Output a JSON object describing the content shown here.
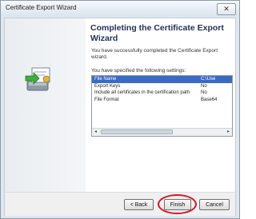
{
  "window": {
    "title": "Certificate Export Wizard",
    "close_label": "✕"
  },
  "content": {
    "heading": "Completing the Certificate Export Wizard",
    "description": "You have successfully completed the Certificate Export wizard.",
    "settings_label": "You have specified the following settings:"
  },
  "settings": [
    {
      "name": "File Name",
      "value": "C:\\Use",
      "selected": true
    },
    {
      "name": "Export Keys",
      "value": "No",
      "selected": false
    },
    {
      "name": "Include all certificates in the certification path",
      "value": "No",
      "selected": false
    },
    {
      "name": "File Format",
      "value": "Base64",
      "selected": false
    }
  ],
  "scrollbar": {
    "left_arrow": "◂",
    "right_arrow": "▸"
  },
  "buttons": {
    "back": "< Back",
    "finish": "Finish",
    "cancel": "Cancel"
  },
  "colors": {
    "heading": "#1f2f57",
    "selection": "#3a6ac3",
    "highlight_ring": "#d3182b"
  }
}
